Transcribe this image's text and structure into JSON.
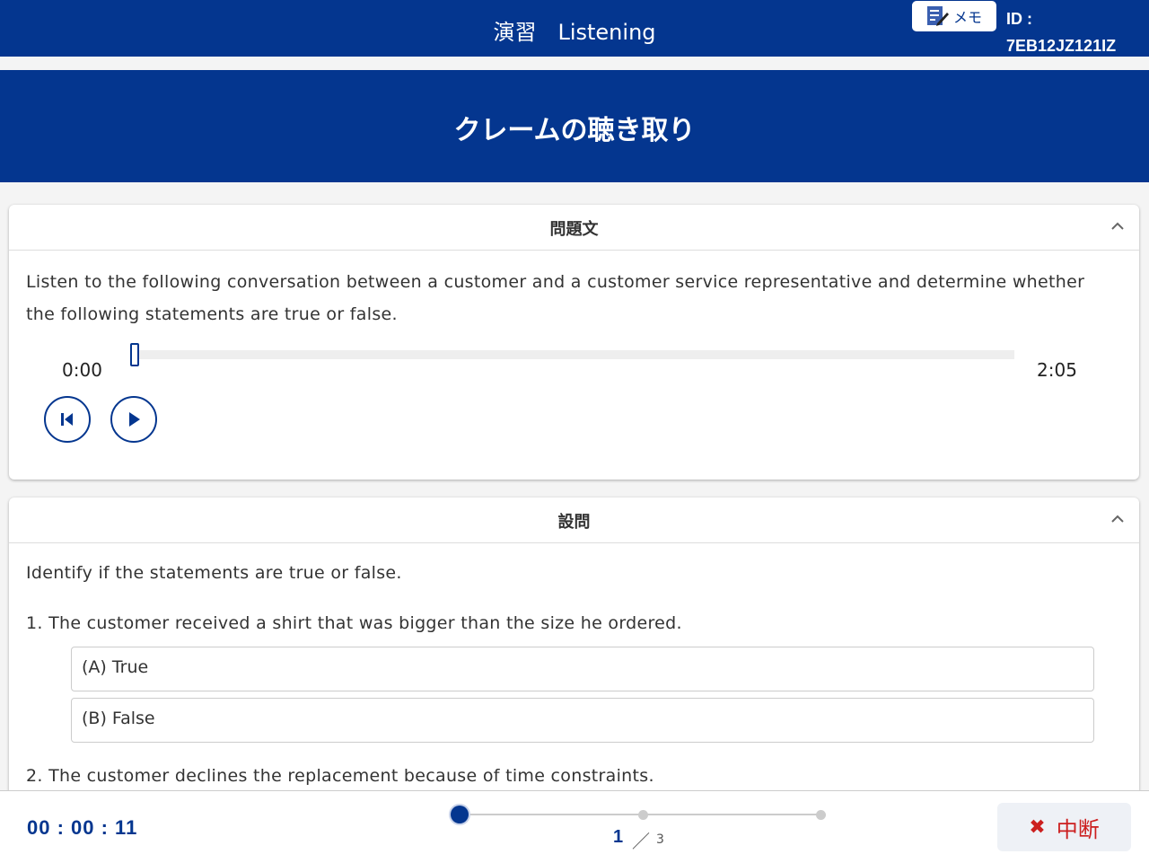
{
  "header": {
    "title": "演習　Listening",
    "memo_label": "メモ",
    "memo_icon": "memo-pencil-icon",
    "id_label": "ID :",
    "id_value": "7EB12JZ121IZ"
  },
  "lesson": {
    "title": "クレームの聴き取り"
  },
  "problem": {
    "heading": "問題文",
    "text_line1": "Listen to the following conversation between a customer and a customer service representative and determine whether",
    "text_line2": "the following statements are true or false.",
    "audio": {
      "current_time": "0:00",
      "duration": "2:05",
      "progress": 0
    }
  },
  "questions": {
    "heading": "設問",
    "instruction": "Identify if the statements are true or false.",
    "items": [
      {
        "text": "1. The customer received a shirt that was bigger than the size he ordered.",
        "options": [
          "(A) True",
          "(B) False"
        ]
      },
      {
        "text": "2. The customer declines the replacement because of time constraints."
      }
    ]
  },
  "footer": {
    "timer": "00 : 00 : 11",
    "page_current": "1",
    "page_sep": "／",
    "page_total": "3",
    "stop_label": "中断",
    "stop_icon": "close-x-icon"
  },
  "colors": {
    "brand": "#04368f",
    "danger": "#cc1f1f"
  }
}
